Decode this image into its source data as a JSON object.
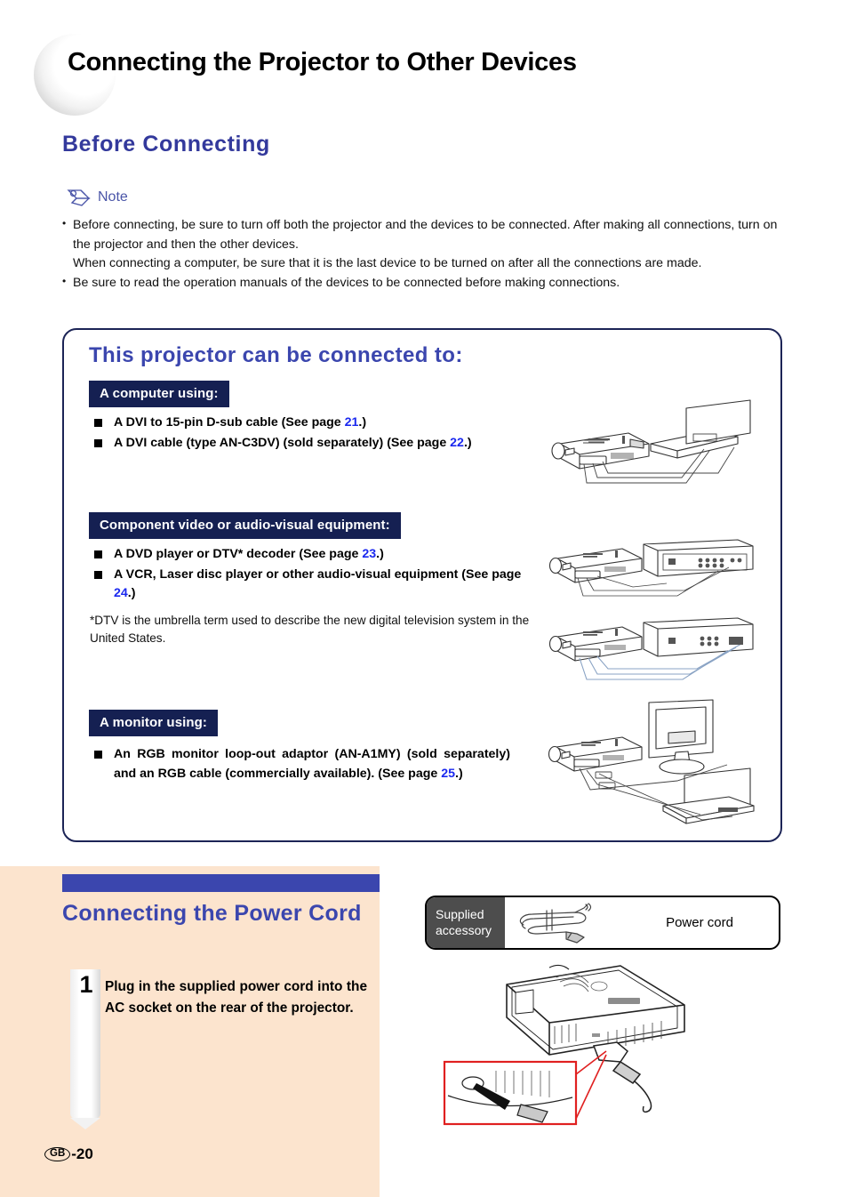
{
  "page": {
    "title": "Connecting the Projector to Other Devices",
    "marker_region": "GB",
    "marker_number": "-20"
  },
  "before_connecting": {
    "heading": "Before Connecting",
    "note_label": "Note",
    "note_icon": "pencil-icon",
    "notes": [
      "Before connecting, be sure to turn off both the projector and the devices to be connected. After making all connections, turn on the projector and then the other devices.",
      "When connecting a computer, be sure that it is the last device to be turned on after all the connections are made.",
      "Be sure to read the operation manuals of the devices to be connected before making connections."
    ]
  },
  "connection_panel": {
    "title": "This projector can be connected to:",
    "categories": [
      {
        "chip": "A computer using:",
        "items": [
          {
            "pre": "A DVI to 15-pin D-sub cable (See page ",
            "page": "21",
            "post": ".)"
          },
          {
            "pre": "A DVI cable (type AN-C3DV) (sold separately) (See page ",
            "page": "22",
            "post": ".)"
          }
        ]
      },
      {
        "chip": "Component video or audio-visual equipment:",
        "items": [
          {
            "pre": "A DVD player or DTV* decoder (See page ",
            "page": "23",
            "post": ".)"
          },
          {
            "pre": "A VCR, Laser disc player or other audio-visual equipment (See page ",
            "page": "24",
            "post": ".)"
          }
        ]
      },
      {
        "chip": "A monitor using:",
        "items": [
          {
            "pre": "An RGB monitor loop-out adaptor (AN-A1MY) (sold separately) and an RGB cable (commercially available). (See page ",
            "page": "25",
            "post": ".)"
          }
        ]
      }
    ],
    "footnote": "*DTV is the umbrella term used to describe the new digital television system in the United States.",
    "illustrations": [
      "projector-to-laptop-illustration",
      "projector-to-dvd-player-illustration",
      "projector-to-vcr-illustration",
      "projector-to-monitor-and-laptop-illustration"
    ]
  },
  "power_cord": {
    "heading": "Connecting the Power Cord",
    "step_number": "1",
    "step_text": "Plug in the supplied power cord into the AC socket on the rear of the projector.",
    "accessory": {
      "label_line1": "Supplied",
      "label_line2": "accessory",
      "item_name": "Power cord",
      "icon": "power-cord-icon"
    },
    "illustration": "projector-ac-socket-illustration"
  },
  "colors": {
    "heading_blue": "#3b46ae",
    "chip_navy": "#152052",
    "link_blue": "#1a28ef",
    "peach": "#fce4ce",
    "accessory_grey": "#4d4d4d",
    "callout_red": "#e02020"
  }
}
